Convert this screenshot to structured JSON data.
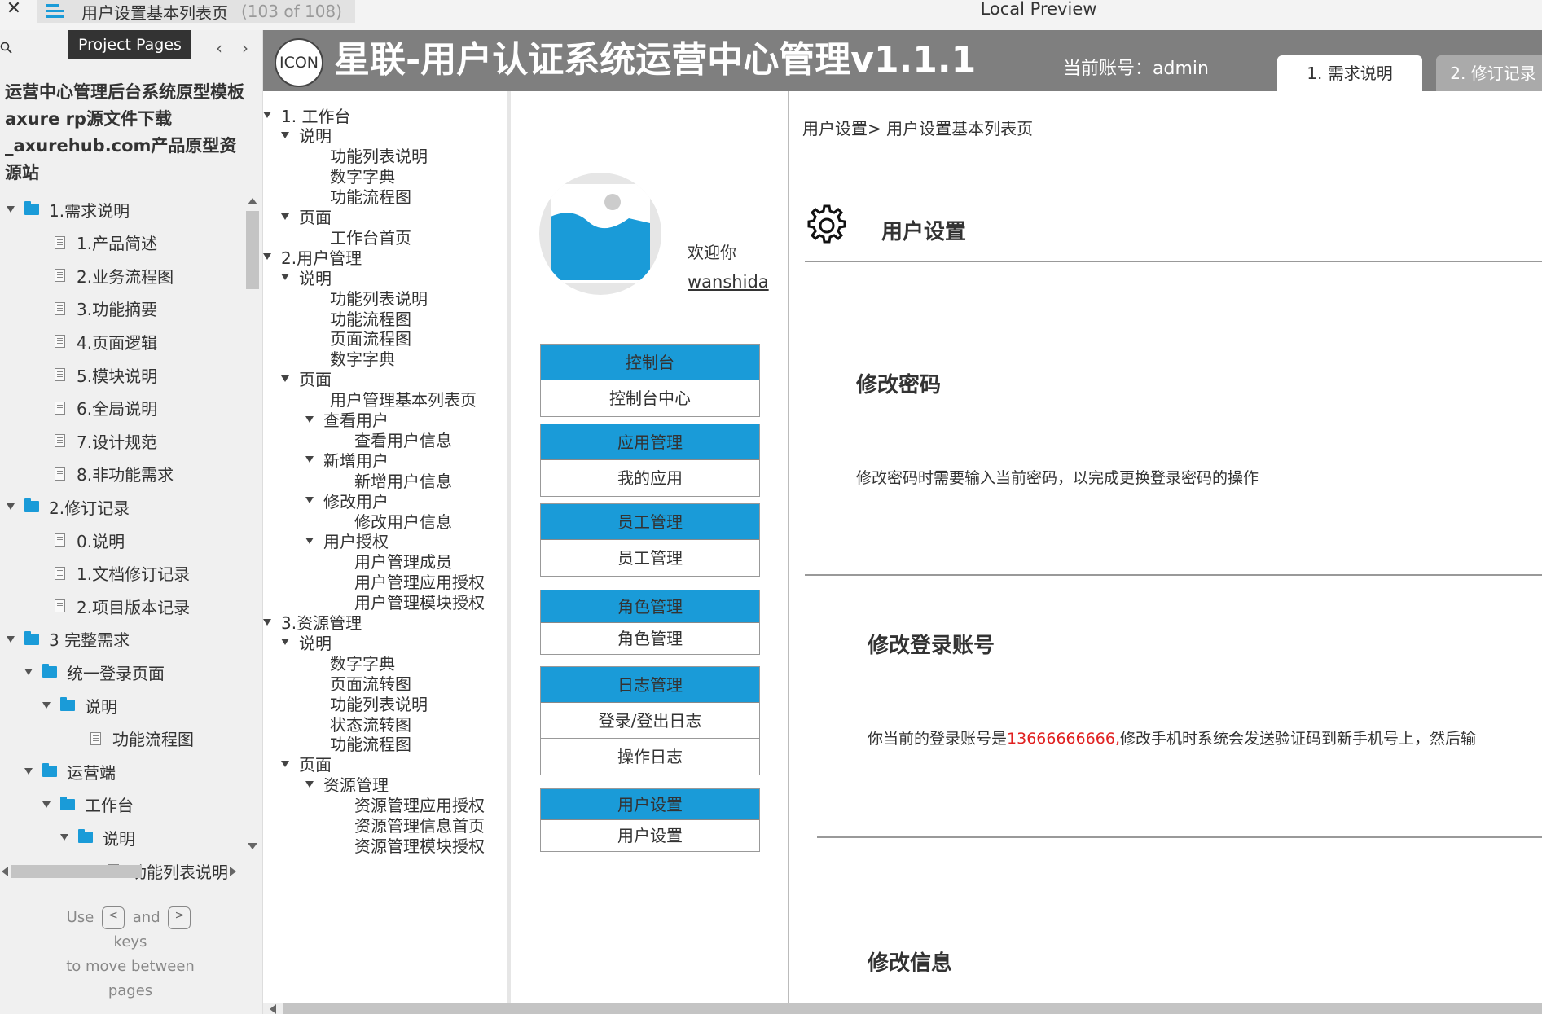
{
  "topbar": {
    "close": "✕",
    "page_title": "用户设置基本列表页",
    "page_count": "(103 of 108)",
    "preview_title": "Local Preview"
  },
  "sidebar": {
    "tooltip": "Project Pages",
    "prev": "‹",
    "next": "›",
    "project_title": "运营中心管理后台系统原型模板axure rp源文件下载_axurehub.com产品原型资源站",
    "tree": [
      {
        "label": "1.需求说明",
        "type": "folder",
        "level": 0,
        "expanded": true
      },
      {
        "label": "1.产品简述",
        "type": "page",
        "level": 1
      },
      {
        "label": "2.业务流程图",
        "type": "page",
        "level": 1
      },
      {
        "label": "3.功能摘要",
        "type": "page",
        "level": 1
      },
      {
        "label": "4.页面逻辑",
        "type": "page",
        "level": 1
      },
      {
        "label": "5.模块说明",
        "type": "page",
        "level": 1
      },
      {
        "label": "6.全局说明",
        "type": "page",
        "level": 1
      },
      {
        "label": "7.设计规范",
        "type": "page",
        "level": 1
      },
      {
        "label": "8.非功能需求",
        "type": "page",
        "level": 1
      },
      {
        "label": "2.修订记录",
        "type": "folder",
        "level": 0,
        "expanded": true
      },
      {
        "label": "0.说明",
        "type": "page",
        "level": 1
      },
      {
        "label": "1.文档修订记录",
        "type": "page",
        "level": 1
      },
      {
        "label": "2.项目版本记录",
        "type": "page",
        "level": 1
      },
      {
        "label": "3 完整需求",
        "type": "folder",
        "level": 0,
        "expanded": true
      },
      {
        "label": "统一登录页面",
        "type": "folder",
        "level": 1,
        "expanded": true
      },
      {
        "label": "说明",
        "type": "folder",
        "level": 2,
        "expanded": true
      },
      {
        "label": "功能流程图",
        "type": "page",
        "level": 3
      },
      {
        "label": "运营端",
        "type": "folder",
        "level": 1,
        "expanded": true
      },
      {
        "label": "工作台",
        "type": "folder",
        "level": 2,
        "expanded": true
      },
      {
        "label": "说明",
        "type": "folder",
        "level": 3,
        "expanded": true
      },
      {
        "label": "功能列表说明",
        "type": "page",
        "level": 4
      }
    ],
    "help": {
      "use": "Use",
      "key_prev": "<",
      "and": "and",
      "key_next": ">",
      "keys": "keys",
      "line3": "to move between",
      "line4": "pages"
    }
  },
  "header": {
    "logo": "ICON",
    "app_title": "星联-用户认证系统运营中心管理v1.1.1",
    "account": "当前账号：admin",
    "tabs": [
      "1. 需求说明",
      "2. 修订记录"
    ]
  },
  "page_tree": [
    {
      "label": "1. 工作台",
      "level": 0,
      "caret": true
    },
    {
      "label": "说明",
      "level": 1,
      "caret": true
    },
    {
      "label": "功能列表说明",
      "level": 2,
      "caret": false
    },
    {
      "label": "数字字典",
      "level": 2,
      "caret": false
    },
    {
      "label": "功能流程图",
      "level": 2,
      "caret": false
    },
    {
      "label": "页面",
      "level": 1,
      "caret": true
    },
    {
      "label": "工作台首页",
      "level": 2,
      "caret": false
    },
    {
      "label": "2.用户管理",
      "level": 0,
      "caret": true
    },
    {
      "label": "说明",
      "level": 1,
      "caret": true
    },
    {
      "label": "功能列表说明",
      "level": 2,
      "caret": false
    },
    {
      "label": "功能流程图",
      "level": 2,
      "caret": false
    },
    {
      "label": "页面流程图",
      "level": 2,
      "caret": false
    },
    {
      "label": "数字字典",
      "level": 2,
      "caret": false
    },
    {
      "label": "页面",
      "level": 1,
      "caret": true
    },
    {
      "label": "用户管理基本列表页",
      "level": 2,
      "caret": false
    },
    {
      "label": "查看用户",
      "level": 2,
      "caret": true
    },
    {
      "label": "查看用户信息",
      "level": 3,
      "caret": false
    },
    {
      "label": "新增用户",
      "level": 2,
      "caret": true
    },
    {
      "label": "新增用户信息",
      "level": 3,
      "caret": false
    },
    {
      "label": "修改用户",
      "level": 2,
      "caret": true
    },
    {
      "label": "修改用户信息",
      "level": 3,
      "caret": false
    },
    {
      "label": "用户授权",
      "level": 2,
      "caret": true
    },
    {
      "label": "用户管理成员",
      "level": 3,
      "caret": false
    },
    {
      "label": "用户管理应用授权",
      "level": 3,
      "caret": false
    },
    {
      "label": "用户管理模块授权",
      "level": 3,
      "caret": false
    },
    {
      "label": "3.资源管理",
      "level": 0,
      "caret": true
    },
    {
      "label": "说明",
      "level": 1,
      "caret": true
    },
    {
      "label": "数字字典",
      "level": 2,
      "caret": false
    },
    {
      "label": "页面流转图",
      "level": 2,
      "caret": false
    },
    {
      "label": "功能列表说明",
      "level": 2,
      "caret": false
    },
    {
      "label": "状态流转图",
      "level": 2,
      "caret": false
    },
    {
      "label": "功能流程图",
      "level": 2,
      "caret": false
    },
    {
      "label": "页面",
      "level": 1,
      "caret": true
    },
    {
      "label": "资源管理",
      "level": 2,
      "caret": true
    },
    {
      "label": "资源管理应用授权",
      "level": 3,
      "caret": false
    },
    {
      "label": "资源管理信息首页",
      "level": 3,
      "caret": false
    },
    {
      "label": "资源管理模块授权",
      "level": 3,
      "caret": false
    }
  ],
  "proto": {
    "welcome": "欢迎你",
    "username": "wanshida",
    "menu": [
      {
        "head": "控制台",
        "items": [
          "控制台中心"
        ]
      },
      {
        "head": "应用管理",
        "items": [
          "我的应用"
        ]
      },
      {
        "head": "员工管理",
        "items": [
          "员工管理"
        ]
      },
      {
        "head": "角色管理",
        "items": [
          "角色管理"
        ]
      },
      {
        "head": "日志管理",
        "items": [
          "登录/登出日志",
          "操作日志"
        ]
      },
      {
        "head": "用户设置",
        "items": [
          "用户设置"
        ]
      }
    ]
  },
  "content": {
    "breadcrumb": "用户设置>  用户设置基本列表页",
    "section_title": "用户设置",
    "password_title": "修改密码",
    "password_desc": "修改密码时需要输入当前密码，以完成更换登录密码的操作",
    "account_title": "修改登录账号",
    "account_desc_prefix": "你当前的登录账号是",
    "account_phone": "13666666666,",
    "account_desc_suffix": "修改手机时系统会发送验证码到新手机号上，然后输",
    "info_title": "修改信息"
  },
  "colors": {
    "accent": "#1a9bd8",
    "banner": "#7f7f7f",
    "highlight_red": "#e02020"
  }
}
